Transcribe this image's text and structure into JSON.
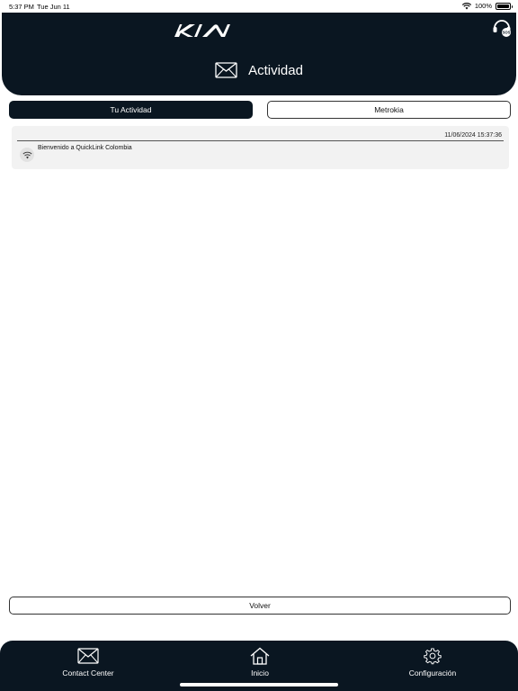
{
  "status_bar": {
    "time": "5:37 PM",
    "date": "Tue Jun 11",
    "battery": "100%"
  },
  "header": {
    "logo": "KIA",
    "title": "Actividad",
    "title_icon": "envelope-icon",
    "sos_icon": "sos-headset-icon"
  },
  "tabs": [
    {
      "label": "Tu Actividad",
      "active": true
    },
    {
      "label": "Metrokia",
      "active": false
    }
  ],
  "activities": [
    {
      "timestamp": "11/06/2024 15:37:36",
      "message": "Bienvenido a QuickLink Colombia",
      "icon": "wifi-icon"
    }
  ],
  "back_button": {
    "label": "Volver"
  },
  "bottom_nav": [
    {
      "label": "Contact Center",
      "icon": "envelope-icon"
    },
    {
      "label": "Inicio",
      "icon": "home-icon"
    },
    {
      "label": "Configuración",
      "icon": "gear-icon"
    }
  ],
  "colors": {
    "primary_dark": "#0a1621",
    "item_background": "#f2f2f2"
  }
}
